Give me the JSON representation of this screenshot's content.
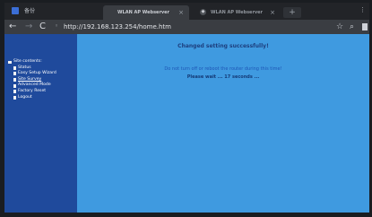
{
  "browser": {
    "app_title": "备份",
    "tabs": [
      {
        "label": "WLAN AP Webserver",
        "active": true
      },
      {
        "label": "WLAN AP Webserver",
        "active": false
      }
    ],
    "url": "http://192.168.123.254/home.htm"
  },
  "sidebar": {
    "root_label": "Site contents:",
    "items": [
      {
        "label": "Status"
      },
      {
        "label": "Easy Setup Wizard"
      },
      {
        "label": "Site Survey"
      },
      {
        "label": "Advanced Mode"
      },
      {
        "label": "Factory Reset"
      },
      {
        "label": "Logout"
      }
    ]
  },
  "main": {
    "title": "Changed setting successfully!",
    "warning": "Do not turn off or reboot the router during this time!",
    "wait_prefix": "Please wait ...",
    "countdown": "17",
    "wait_suffix": "seconds ..."
  }
}
